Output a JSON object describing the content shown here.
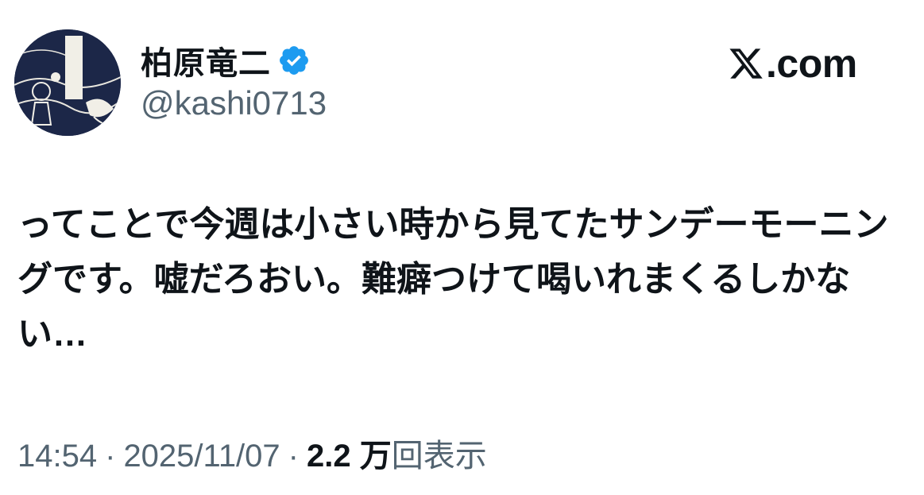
{
  "author": {
    "display_name": "柏原竜二",
    "handle": "@kashi0713",
    "verified": true,
    "avatar": "illustrated-avatar"
  },
  "brand": {
    "logo": "x-logo-icon",
    "text": ".com"
  },
  "tweet": {
    "text": "ってことで今週は小さい時から見てたサンデーモーニングです。嘘だろおい。難癖つけて喝いれまくるしかない…"
  },
  "meta": {
    "time": "14:54",
    "separator": "·",
    "date": "2025/11/07",
    "views_count": "2.2 万",
    "views_suffix": "回表示"
  },
  "colors": {
    "text_primary": "#0f1419",
    "text_secondary": "#536471",
    "verified_blue": "#1d9bf0",
    "background": "#ffffff"
  }
}
